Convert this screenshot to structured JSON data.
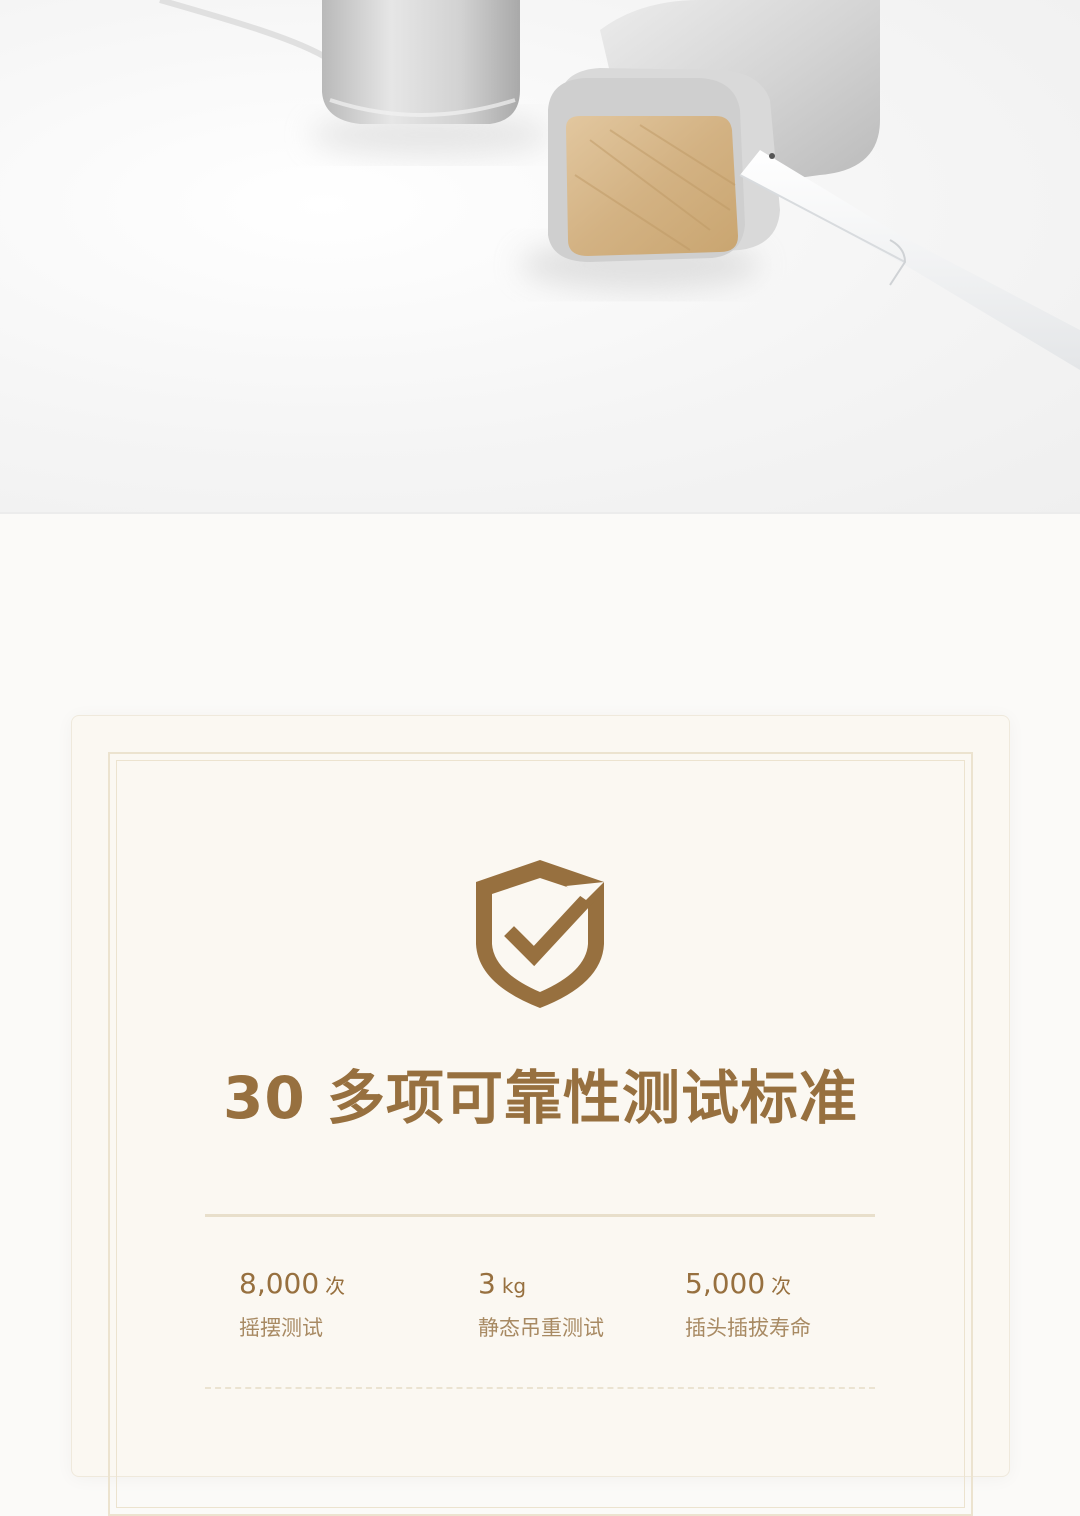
{
  "hero": {
    "image_description_name": "earphones-photo"
  },
  "card": {
    "icon": "shield-check-icon",
    "headline": "30 多项可靠性测试标准",
    "stats": [
      {
        "value": "8,000",
        "unit": "次",
        "label": "摇摆测试"
      },
      {
        "value": "3",
        "unit": "kg",
        "label": "静态吊重测试"
      },
      {
        "value": "5,000",
        "unit": "次",
        "label": "插头插拔寿命"
      }
    ]
  },
  "colors": {
    "accent": "#97703f",
    "card_bg": "#fbf8f2",
    "frame": "#ece3cf"
  }
}
